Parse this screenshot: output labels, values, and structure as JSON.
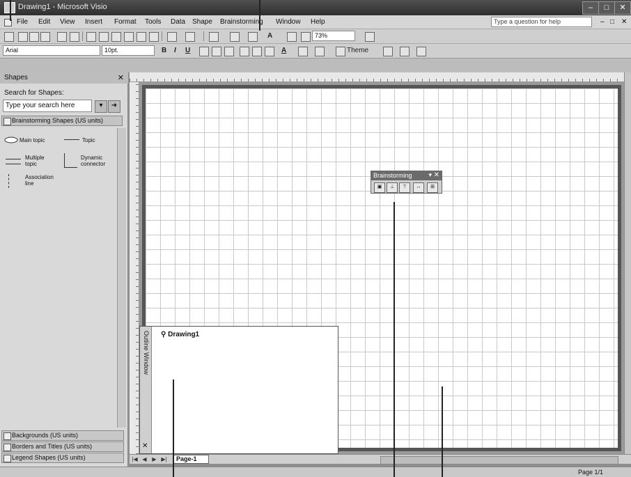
{
  "window": {
    "title": "Drawing1 - Microsoft Visio",
    "minimize": "–",
    "maximize": "□",
    "close": "✕"
  },
  "menu": {
    "items": [
      "File",
      "Edit",
      "View",
      "Insert",
      "Format",
      "Tools",
      "Data",
      "Shape",
      "Brainstorming",
      "Window",
      "Help"
    ],
    "help_placeholder": "Type a question for help"
  },
  "toolbar": {
    "zoom": "73%",
    "font": "Arial",
    "font_size": "10pt.",
    "theme_label": "Theme"
  },
  "shapes_pane": {
    "title": "Shapes",
    "search_label": "Search for Shapes:",
    "search_placeholder": "Type your search here",
    "active_stencil": "Brainstorming Shapes (US units)",
    "shapes": [
      "Main topic",
      "Topic",
      "Multiple topic",
      "Dynamic connector",
      "Association line"
    ],
    "stencils": [
      "Backgrounds (US units)",
      "Borders and Titles (US units)",
      "Legend Shapes (US units)"
    ]
  },
  "brainstorming_toolbar": {
    "title": "Brainstorming"
  },
  "outline_window": {
    "title": "Outline Window",
    "root": "Drawing1"
  },
  "page_tab": "Page-1",
  "status": {
    "page": "Page 1/1"
  }
}
